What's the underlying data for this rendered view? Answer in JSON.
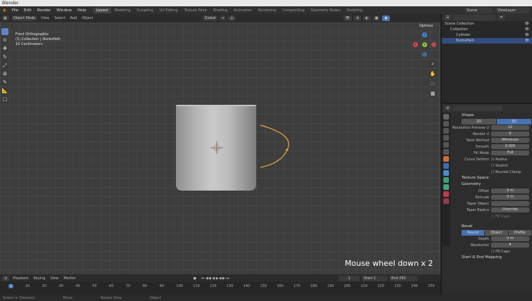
{
  "window_title": "Blender",
  "menu": [
    "File",
    "Edit",
    "Render",
    "Window",
    "Help"
  ],
  "workspace_tabs": [
    "Layout",
    "Modeling",
    "Sculpting",
    "UV Editing",
    "Texture Paint",
    "Shading",
    "Animation",
    "Rendering",
    "Compositing",
    "Geometry Nodes",
    "Scripting"
  ],
  "active_workspace_index": 0,
  "scene_label": "Scene",
  "view_layer_label": "ViewLayer",
  "viewport_header": {
    "mode": "Object Mode",
    "menus": [
      "View",
      "Select",
      "Add",
      "Object"
    ],
    "transform": "Global",
    "options": "Options"
  },
  "viewport_overlay": {
    "view_name": "Front Orthographic",
    "collection": "(1) Collection | NurbsPath",
    "scale": "10 Centimeters"
  },
  "keystroke": "Mouse wheel down x 2",
  "timeline": {
    "menus": [
      "Playback",
      "Keying",
      "View",
      "Marker"
    ],
    "current_frame": "1",
    "start_label": "Start",
    "start": "1",
    "end_label": "End",
    "end": "250",
    "frames": [
      "1",
      "10",
      "20",
      "30",
      "40",
      "50",
      "60",
      "70",
      "80",
      "90",
      "100",
      "110",
      "120",
      "130",
      "140",
      "150",
      "160",
      "170",
      "180",
      "190",
      "200",
      "210",
      "220",
      "230",
      "240",
      "250"
    ]
  },
  "status": [
    "Select or Deselect",
    "Move",
    "Rotate View",
    "Object"
  ],
  "outliner": {
    "rows": [
      {
        "label": "Scene Collection",
        "indent": 0,
        "selected": false
      },
      {
        "label": "Collection",
        "indent": 1,
        "selected": false
      },
      {
        "label": "Cylinder",
        "indent": 2,
        "selected": false
      },
      {
        "label": "NurbsPath",
        "indent": 2,
        "selected": true
      }
    ]
  },
  "properties": {
    "search_placeholder": "",
    "shape": {
      "title": "Shape",
      "dims": [
        "2D",
        "3D"
      ],
      "active_dim": "3D",
      "rows": [
        {
          "label": "Resolution Preview U",
          "value": "12"
        },
        {
          "label": "Render U",
          "value": "0"
        },
        {
          "label": "Twist Method",
          "value": "Minimum"
        },
        {
          "label": "Smooth",
          "value": "0.000"
        },
        {
          "label": "Fill Mode",
          "value": "Full"
        }
      ],
      "curve_deform_label": "Curve Deform",
      "checks": [
        "Radius",
        "Stretch",
        "Bounds Clamp"
      ]
    },
    "texture_space": "Texture Space",
    "geometry": {
      "title": "Geometry",
      "rows": [
        {
          "label": "Offset",
          "value": "0 m"
        },
        {
          "label": "Extrude",
          "value": "0 m"
        },
        {
          "label": "Taper Object",
          "value": ""
        },
        {
          "label": "Taper Radius",
          "value": "Override"
        }
      ],
      "fill_caps": "Fill Caps"
    },
    "bevel": {
      "title": "Bevel",
      "modes": [
        "Round",
        "Object",
        "Profile"
      ],
      "active_mode": "Round",
      "rows": [
        {
          "label": "Depth",
          "value": "0 m"
        },
        {
          "label": "Resolution",
          "value": "4"
        }
      ],
      "fill_caps": "Fill Caps"
    },
    "start_end": "Start & End Mapping"
  },
  "colors": {
    "accent": "#4772b3",
    "curve": "#e8a93a",
    "x_axis": "#e0475a",
    "y_axis": "#8ac838",
    "z_axis": "#3c8ee0"
  }
}
